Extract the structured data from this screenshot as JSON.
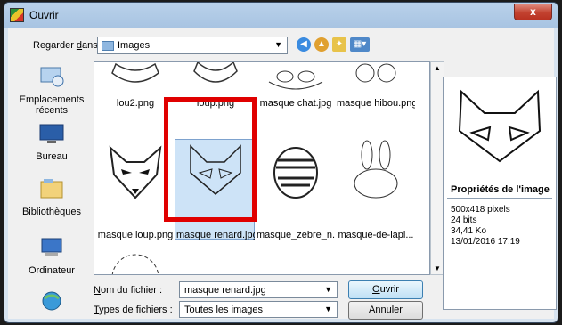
{
  "window": {
    "title": "Ouvrir",
    "close_glyph": "x"
  },
  "lookin": {
    "label_prefix": "Regarder ",
    "label_u": "d",
    "label_suffix": "ans :",
    "folder": "Images"
  },
  "places": [
    {
      "label": "Emplacements récents",
      "icon": "recent-places-icon"
    },
    {
      "label": "Bureau",
      "icon": "desktop-icon"
    },
    {
      "label": "Bibliothèques",
      "icon": "libraries-icon"
    },
    {
      "label": "Ordinateur",
      "icon": "computer-icon"
    },
    {
      "label": "",
      "icon": "network-icon"
    }
  ],
  "files_row1": [
    "lou2.png",
    "loup.png",
    "masque chat.jpg",
    "masque hibou.png"
  ],
  "files_row2": [
    "masque loup.png",
    "masque renard.jpg",
    "masque_zebre_n...",
    "masque-de-lapi..."
  ],
  "preview": {
    "section_title": "Propriétés de l'image",
    "dimensions": "500x418 pixels",
    "bits": "24 bits",
    "size": "34,41 Ko",
    "date": "13/01/2016 17:19"
  },
  "filename": {
    "label_u": "N",
    "label_rest": "om du fichier :",
    "value": "masque renard.jpg"
  },
  "filetype": {
    "label_u": "T",
    "label_rest": "ypes de fichiers :",
    "value": "Toutes les images"
  },
  "buttons": {
    "open_u": "O",
    "open_rest": "uvrir",
    "cancel": "Annuler"
  },
  "colors": {
    "highlight": "#e00000",
    "selection": "#cde3f7"
  }
}
